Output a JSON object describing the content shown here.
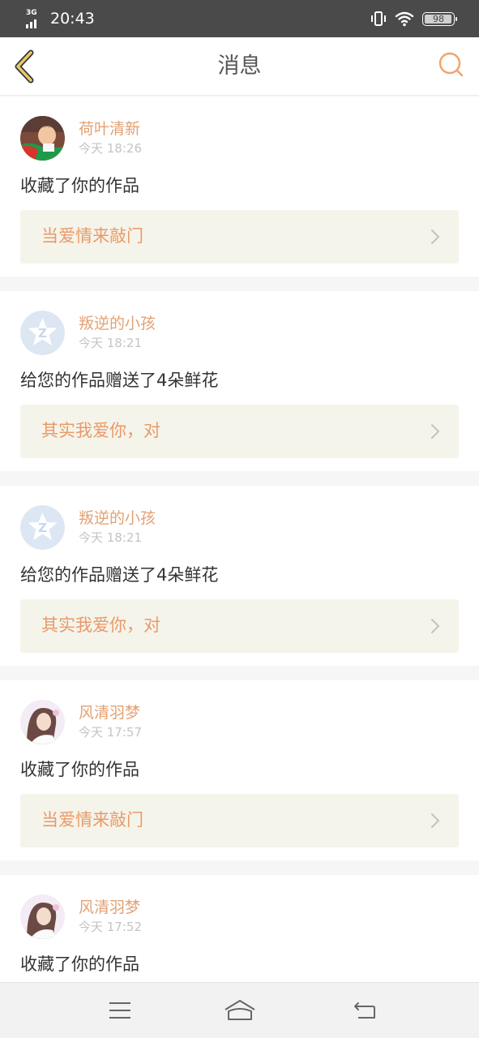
{
  "status_bar": {
    "network": "3G",
    "time": "20:43",
    "battery": "98",
    "battery_level": 0.98
  },
  "header": {
    "title": "消息",
    "back_icon": "chevron-left-icon",
    "search_icon": "search-icon"
  },
  "colors": {
    "accent": "#e89a6a",
    "back_icon": "#e6c96a",
    "card_link_bg": "#f5f4ea"
  },
  "messages": [
    {
      "user": "荷叶清新",
      "time": "今天 18:26",
      "action": "收藏了你的作品",
      "work": "当爱情来敲门",
      "avatar": "boy-photo-avatar"
    },
    {
      "user": "叛逆的小孩",
      "time": "今天 18:21",
      "action": "给您的作品赠送了4朵鲜花",
      "work": "其实我爱你，对",
      "avatar": "default-qq-avatar"
    },
    {
      "user": "叛逆的小孩",
      "time": "今天 18:21",
      "action": "给您的作品赠送了4朵鲜花",
      "work": "其实我爱你，对",
      "avatar": "default-qq-avatar"
    },
    {
      "user": "风清羽梦",
      "time": "今天 17:57",
      "action": "收藏了你的作品",
      "work": "当爱情来敲门",
      "avatar": "girl-photo-avatar"
    },
    {
      "user": "风清羽梦",
      "time": "今天 17:52",
      "action": "收藏了你的作品",
      "work": "",
      "avatar": "girl-photo-avatar"
    }
  ],
  "nav_bar": {
    "menu_icon": "menu-icon",
    "home_icon": "home-icon",
    "back_icon": "back-arrow-icon"
  }
}
